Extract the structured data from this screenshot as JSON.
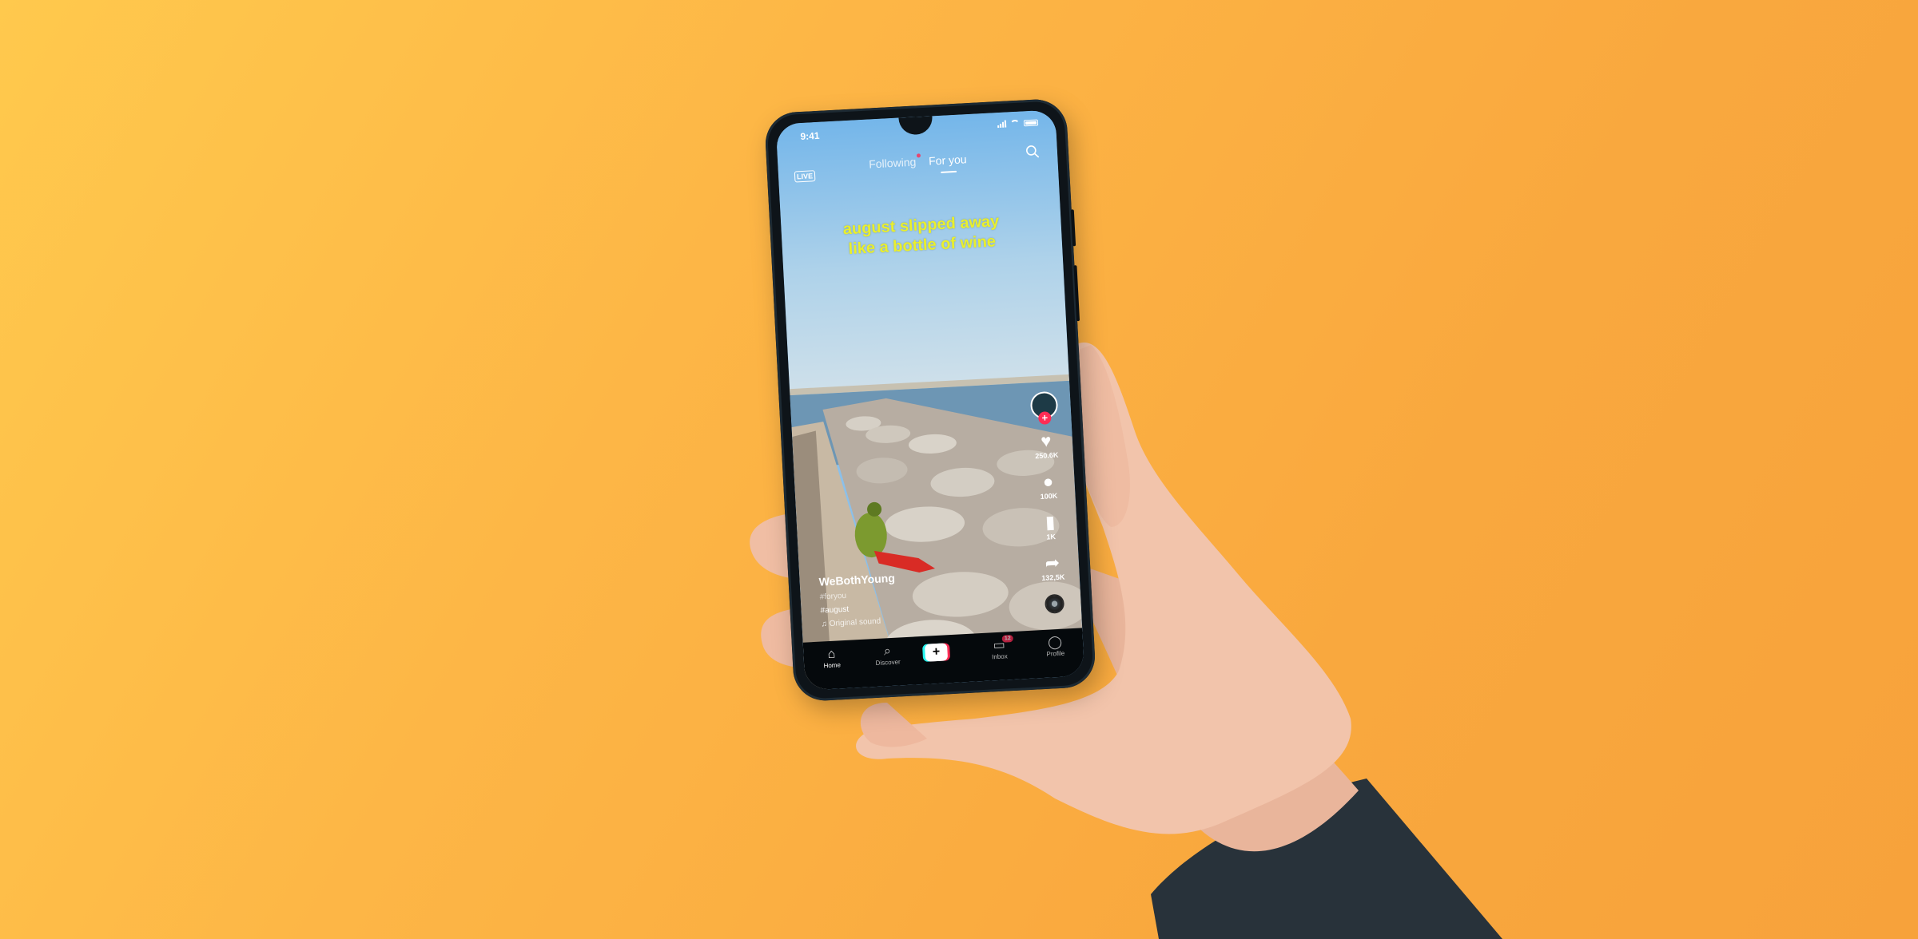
{
  "status_bar": {
    "time": "9:41"
  },
  "header": {
    "live_label": "LIVE",
    "tabs": [
      {
        "label": "Following",
        "has_dot": true
      },
      {
        "label": "For you",
        "active": true
      }
    ]
  },
  "video": {
    "caption_lines": [
      "august slipped away",
      "like a bottle of wine"
    ],
    "author": "WeBothYoung",
    "line_1": "#august",
    "line_2": "#foryou",
    "music": "♫ Original sound"
  },
  "actions": [
    {
      "icon": "heart-icon",
      "glyph": "♥",
      "count": "250.6K"
    },
    {
      "icon": "comment-icon",
      "glyph": "●",
      "count": "100K"
    },
    {
      "icon": "bookmark-icon",
      "glyph": "▮",
      "count": "1K"
    },
    {
      "icon": "share-icon",
      "glyph": "➦",
      "count": "132,5K"
    }
  ],
  "avatar_plus": "+",
  "bottom_nav": {
    "home": {
      "label": "Home",
      "glyph": "⌂"
    },
    "discover": {
      "label": "Discover",
      "glyph": "⌕"
    },
    "create": {
      "glyph": "+"
    },
    "inbox": {
      "label": "Inbox",
      "glyph": "▭",
      "badge": "12"
    },
    "profile": {
      "label": "Profile",
      "glyph": "◯"
    }
  },
  "colors": {
    "background": "#f9a83e",
    "caption": "#e9ef2d",
    "accent_red": "#fe2c55",
    "accent_cyan": "#25f4ee"
  }
}
